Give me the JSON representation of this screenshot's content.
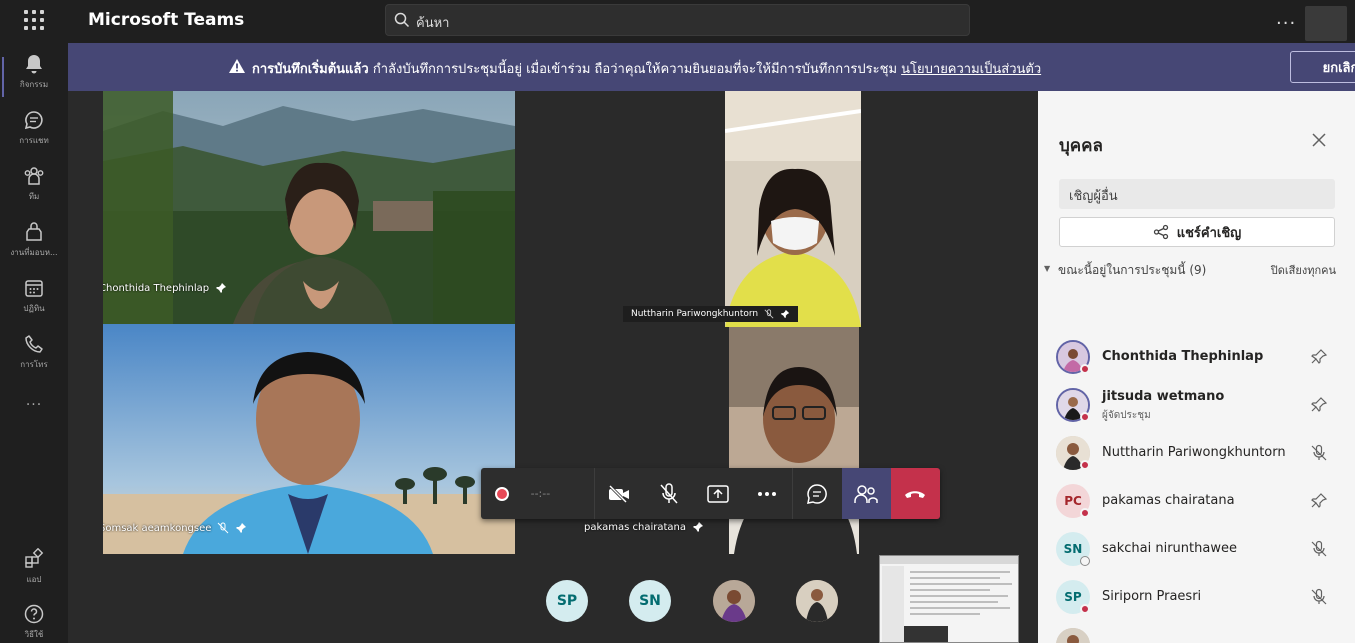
{
  "app": {
    "title": "Microsoft Teams"
  },
  "search": {
    "placeholder": "ค้นหา"
  },
  "titlebar": {
    "more": "..."
  },
  "rail": {
    "items": [
      {
        "label": "กิจกรรม",
        "icon": "bell-icon"
      },
      {
        "label": "การแชท",
        "icon": "chat-icon"
      },
      {
        "label": "ทีม",
        "icon": "teams-icon"
      },
      {
        "label": "งานที่มอบห...",
        "icon": "assignments-icon"
      },
      {
        "label": "ปฏิทิน",
        "icon": "calendar-icon"
      },
      {
        "label": "การโทร",
        "icon": "phone-icon"
      }
    ],
    "more": "...",
    "apps_label": "แอป",
    "help_label": "วิธีใช้"
  },
  "banner": {
    "bold_text": "การบันทึกเริ่มต้นแล้ว",
    "text": "กำลังบันทึกการประชุมนี้อยู่ เมื่อเข้าร่วม ถือว่าคุณให้ความยินยอมที่จะให้มีการบันทึกการประชุม",
    "link": "นโยบายความเป็นส่วนตัว",
    "cancel_label": "ยกเลิก"
  },
  "tiles": [
    {
      "name": "Chonthida Thephinlap"
    },
    {
      "name": "Nuttharin Pariwongkhuntorn"
    },
    {
      "name": "Somsak aeamkongsee"
    },
    {
      "name": "pakamas chairatana"
    }
  ],
  "controls": {
    "timer": "--:--"
  },
  "strip": [
    {
      "initials": "SP"
    },
    {
      "initials": "SN"
    }
  ],
  "panel": {
    "title": "บุคคล",
    "invite_placeholder": "เชิญผู้อื่น",
    "share_label": "แชร์คำเชิญ",
    "section_label": "ขณะนี้อยู่ในการประชุมนี้ (9)",
    "mute_all": "ปิดเสียงทุกคน",
    "people": [
      {
        "name": "Chonthida Thephinlap",
        "bold": true,
        "role": "",
        "icon": "pin-icon",
        "avatar": "photo"
      },
      {
        "name": "jitsuda wetmano",
        "bold": true,
        "role": "ผู้จัดประชุม",
        "icon": "pin-icon",
        "avatar": "photo"
      },
      {
        "name": "Nuttharin Pariwongkhuntorn",
        "bold": false,
        "role": "",
        "icon": "mic-off-icon",
        "avatar": "photo"
      },
      {
        "name": "pakamas chairatana",
        "bold": false,
        "role": "",
        "icon": "pin-icon",
        "initials": "PC",
        "avatar_color": "#f3d6d8",
        "initials_color": "#a4262c"
      },
      {
        "name": "sakchai nirunthawee",
        "bold": false,
        "role": "",
        "icon": "mic-off-icon",
        "initials": "SN",
        "avatar_color": "#d4ecef",
        "initials_color": "#036c70"
      },
      {
        "name": "Siriporn Praesri",
        "bold": false,
        "role": "",
        "icon": "mic-off-icon",
        "initials": "SP",
        "avatar_color": "#d4ecef",
        "initials_color": "#036c70"
      }
    ]
  },
  "colors": {
    "accent": "#6264a7",
    "banner": "#464775",
    "hangup": "#c4314b",
    "record": "#e74856"
  }
}
